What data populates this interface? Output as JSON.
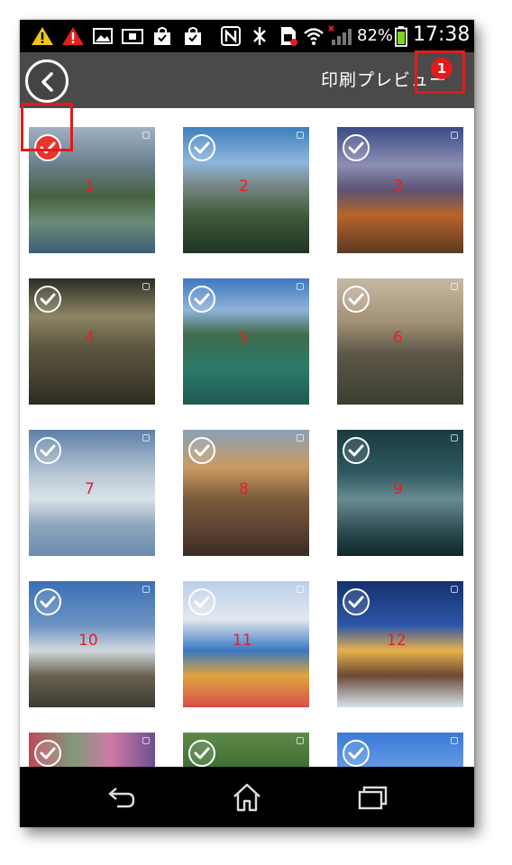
{
  "status_bar": {
    "battery_percent": "82%",
    "time": "17:38",
    "icons": [
      "warning-icon",
      "alert-icon",
      "image-icon",
      "sim-icon",
      "bag-icon",
      "bag-icon",
      "nfc-icon",
      "bluetooth-icon",
      "sim-error-icon",
      "wifi-icon",
      "signal-icon",
      "battery-icon"
    ]
  },
  "action_bar": {
    "title": "印刷プレビュー",
    "back_icon": "chevron-left-icon"
  },
  "annotation": {
    "badge": "1",
    "color": "#e11b1b"
  },
  "grid": {
    "items": [
      {
        "number": "1",
        "selected": true
      },
      {
        "number": "2",
        "selected": false
      },
      {
        "number": "3",
        "selected": false
      },
      {
        "number": "4",
        "selected": false
      },
      {
        "number": "5",
        "selected": false
      },
      {
        "number": "6",
        "selected": false
      },
      {
        "number": "7",
        "selected": false
      },
      {
        "number": "8",
        "selected": false
      },
      {
        "number": "9",
        "selected": false
      },
      {
        "number": "10",
        "selected": false
      },
      {
        "number": "11",
        "selected": false
      },
      {
        "number": "12",
        "selected": false
      },
      {
        "number": "",
        "selected": false
      },
      {
        "number": "",
        "selected": false
      },
      {
        "number": "",
        "selected": false
      }
    ]
  },
  "nav_bar": {
    "buttons": [
      "back-icon",
      "home-icon",
      "recents-icon"
    ]
  },
  "colors": {
    "action_bar": "#4a4a4a",
    "selected_check": "#e8352a",
    "number_label": "#e32222"
  }
}
